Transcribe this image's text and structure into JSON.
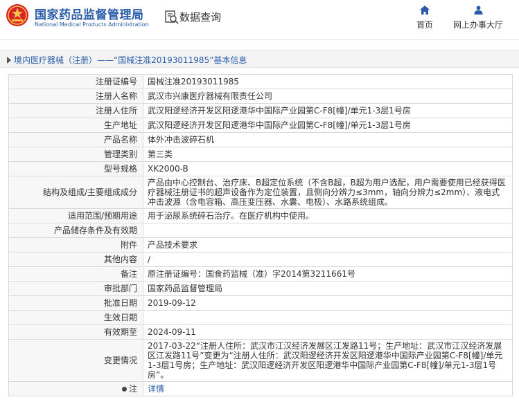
{
  "header": {
    "logo_cn": "国家药品监督管理局",
    "logo_en": "National Medical Products Administration",
    "query_label": "数据查询",
    "nav": {
      "home_label": "首页",
      "service_label": "网上办事大厅"
    }
  },
  "breadcrumb": {
    "text": "境内医疗器械（注册）——“国械注准20193011985”基本信息"
  },
  "rows": [
    {
      "key": "注册证编号",
      "value": "国械注准20193011985"
    },
    {
      "key": "注册人名称",
      "value": "武汉市兴康医疗器械有限责任公司"
    },
    {
      "key": "注册人住所",
      "value": "武汉阳逻经济开发区阳逻港华中国际产业园第C-F8[幢]/单元1-3层1号房"
    },
    {
      "key": "生产地址",
      "value": "武汉阳逻经济开发区阳逻港华中国际产业园第C-F8[幢]/单元1-3层1号房"
    },
    {
      "key": "产品名称",
      "value": "体外冲击波碎石机"
    },
    {
      "key": "管理类别",
      "value": "第三类"
    },
    {
      "key": "型号规格",
      "value": "XK2000-B"
    },
    {
      "key": "结构及组成/主要组成成分",
      "value": "产品由中心控制台、治疗床、B超定位系统（不含B超，B超为用户选配，用户需要使用已经获得医疗器械注册证书的超声设备作为定位装置，且侧向分辨力≤3mm，轴向分辨力≤2mm）、液电式冲击波源（含电容箱、高压变压器、水囊、电极）、水路系统组成。"
    },
    {
      "key": "适用范围/预期用途",
      "value": "用于泌尿系统碎石治疗。在医疗机构中使用。"
    },
    {
      "key": "产品储存条件及有效期",
      "value": ""
    },
    {
      "key": "附件",
      "value": "产品技术要求"
    },
    {
      "key": "其他内容",
      "value": "/"
    },
    {
      "key": "备注",
      "value": "原注册证编号：国食药监械（准）字2014第3211661号"
    },
    {
      "key": "审批部门",
      "value": "国家药品监督管理局"
    },
    {
      "key": "批准日期",
      "value": "2019-09-12"
    },
    {
      "key": "生效日期",
      "value": ""
    },
    {
      "key": "有效期至",
      "value": "2024-09-11"
    },
    {
      "key": "变更情况",
      "value": "2017-03-22“注册人住所：武汉市江汉经济发展区江发路11号；生产地址：武汉市江汉经济发展区江发路11号”变更为“注册人住所：武汉阳逻经济开发区阳逻港华中国际产业园第C-F8[幢]/单元1-3层1号房；生产地址：武汉阳逻经济开发区阳逻港华中国际产业园第C-F8[幢]/单元1-3层1号房”。"
    }
  ],
  "note": {
    "key": "注",
    "link_label": "详情"
  }
}
